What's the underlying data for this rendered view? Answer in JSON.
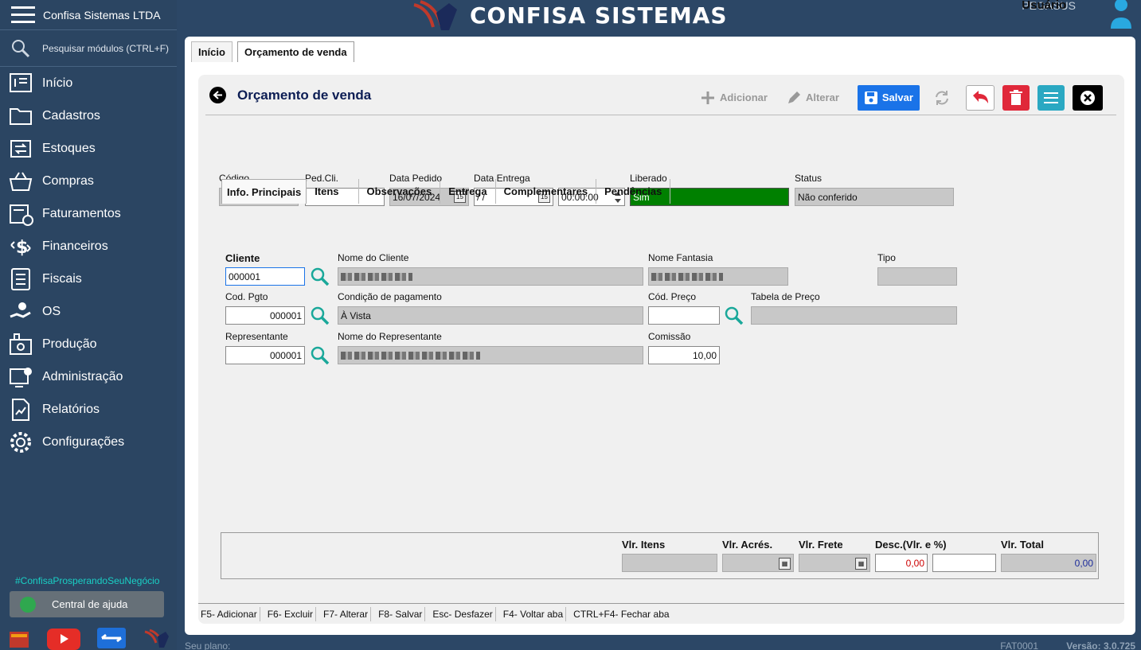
{
  "sidebar": {
    "company": "Confisa Sistemas LTDA",
    "search_placeholder": "Pesquisar módulos (CTRL+F)",
    "items": [
      {
        "label": "Início",
        "icon": "home-icon"
      },
      {
        "label": "Cadastros",
        "icon": "folder-icon"
      },
      {
        "label": "Estoques",
        "icon": "stock-icon"
      },
      {
        "label": "Compras",
        "icon": "basket-icon"
      },
      {
        "label": "Faturamentos",
        "icon": "invoice-icon"
      },
      {
        "label": "Financeiros",
        "icon": "money-icon"
      },
      {
        "label": "Fiscais",
        "icon": "document-icon"
      },
      {
        "label": "OS",
        "icon": "service-icon"
      },
      {
        "label": "Produção",
        "icon": "factory-icon"
      },
      {
        "label": "Administração",
        "icon": "admin-icon"
      },
      {
        "label": "Relatórios",
        "icon": "report-icon"
      },
      {
        "label": "Configurações",
        "icon": "gear-icon"
      }
    ],
    "hashtag": "#ConfisaProsperandoSeuNegócio",
    "help_label": "Central de ajuda"
  },
  "header": {
    "brand": "CONFISA SISTEMAS",
    "user_label": "Usuário",
    "user_name": "PEGASUS"
  },
  "tabs": [
    "Início",
    "Orçamento de venda"
  ],
  "page": {
    "title": "Orçamento de venda",
    "toolbar": {
      "add": "Adicionar",
      "edit": "Alterar",
      "save": "Salvar"
    }
  },
  "header_fields": {
    "codigo_label": "Código",
    "codigo_value": "",
    "pedcli_label": "Ped.Cli.",
    "pedcli_value": "",
    "data_pedido_label": "Data Pedido",
    "data_pedido_value": "16/07/2024",
    "data_entrega_label": "Data Entrega",
    "data_entrega_value": " / /",
    "hora_value": "00:00:00",
    "liberado_label": "Liberado",
    "liberado_value": "Sim",
    "status_label": "Status",
    "status_value": "Não conferido"
  },
  "subtabs": [
    "Info. Principais",
    "Itens",
    "Observações",
    "Entrega",
    "Complementares",
    "Pendências"
  ],
  "form": {
    "cliente_label": "Cliente",
    "cliente_value": "000001",
    "nome_cliente_label": "Nome do Cliente",
    "nome_fantasia_label": "Nome Fantasia",
    "tipo_label": "Tipo",
    "cod_pgto_label": "Cod. Pgto",
    "cod_pgto_value": "000001",
    "cond_pgto_label": "Condição de pagamento",
    "cond_pgto_value": "À Vista",
    "cod_preco_label": "Cód. Preço",
    "cod_preco_value": "",
    "tabela_preco_label": "Tabela de Preço",
    "representante_label": "Representante",
    "representante_value": "000001",
    "nome_representante_label": "Nome do Representante",
    "comissao_label": "Comissão",
    "comissao_value": "10,00"
  },
  "totals": {
    "itens_label": "Vlr. Itens",
    "acres_label": "Vlr. Acrés.",
    "frete_label": "Vlr. Frete",
    "desc_label": "Desc.(Vlr. e %)",
    "desc_value": "0,00",
    "total_label": "Vlr. Total",
    "total_value": "0,00"
  },
  "shortcuts": [
    "F5- Adicionar",
    "F6- Excluir",
    "F7- Alterar",
    "F8- Salvar",
    "Esc- Desfazer",
    "F4- Voltar aba",
    "CTRL+F4- Fechar aba"
  ],
  "footer": {
    "plan": "Seu plano:",
    "code": "FAT0001",
    "version": "Versão: 3.0.725"
  },
  "colors": {
    "sidebar": "#2b4562",
    "save": "#1a73e8",
    "liberado": "#008000",
    "delete": "#e0283a",
    "menu": "#2aa8c2",
    "accent": "#19d0c5"
  }
}
